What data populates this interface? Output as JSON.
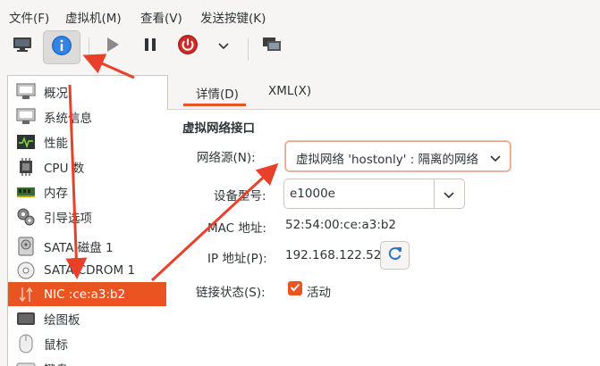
{
  "menubar": {
    "items": [
      "文件(F)",
      "虚拟机(M)",
      "查看(V)",
      "发送按键(K)"
    ]
  },
  "toolbar": {
    "buttons": [
      "console-icon",
      "info-icon",
      "run-icon",
      "pause-icon",
      "power-icon",
      "dropdown-icon",
      "snapshots-icon"
    ]
  },
  "sidebar": {
    "items": [
      {
        "label": "概况",
        "icon": "overview-icon"
      },
      {
        "label": "系统信息",
        "icon": "system-info-icon"
      },
      {
        "label": "性能",
        "icon": "performance-icon"
      },
      {
        "label": "CPU 数",
        "icon": "cpu-icon"
      },
      {
        "label": "内存",
        "icon": "memory-icon"
      },
      {
        "label": "引导选项",
        "icon": "boot-options-icon"
      },
      {
        "label": "SATA 磁盘 1",
        "icon": "disk-icon"
      },
      {
        "label": "SATA CDROM 1",
        "icon": "cdrom-icon"
      },
      {
        "label": "NIC :ce:a3:b2",
        "icon": "nic-icon"
      },
      {
        "label": "绘图板",
        "icon": "tablet-icon"
      },
      {
        "label": "鼠标",
        "icon": "mouse-icon"
      },
      {
        "label": "键盘",
        "icon": "keyboard-icon"
      }
    ],
    "selected_index": 8
  },
  "tabs": {
    "details": "详情(D)",
    "xml": "XML(X)"
  },
  "nic": {
    "section_title": "虚拟网络接口",
    "source_label": "网络源(N):",
    "source_value": "虚拟网络 'hostonly' : 隔离的网络",
    "device_model_label": "设备型号:",
    "device_model_value": "e1000e",
    "mac_label": "MAC 地址:",
    "mac_value": "52:54:00:ce:a3:b2",
    "ip_label": "IP 地址(P):",
    "ip_value": "192.168.122.52",
    "link_state_label": "链接状态(S):",
    "link_state_value": "活动",
    "link_state_checked": true
  },
  "colors": {
    "accent": "#e95420",
    "arrow": "#e8402a"
  }
}
